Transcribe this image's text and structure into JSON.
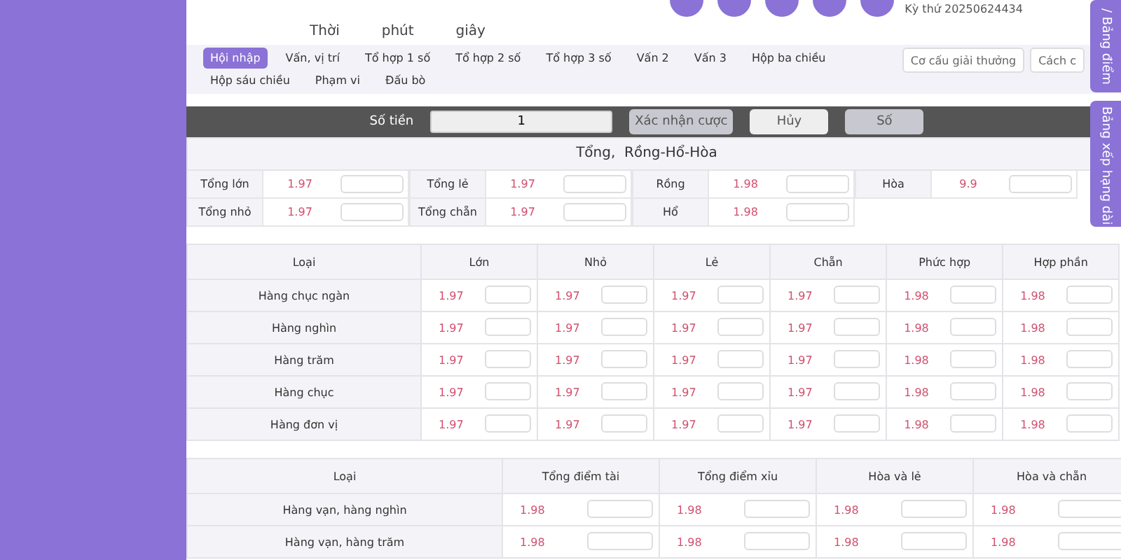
{
  "header": {
    "time_labels": [
      "Thời",
      "phút",
      "giây"
    ],
    "draw_label": "Kỳ thứ 20250624434"
  },
  "tabs": [
    {
      "label": "Hội nhập",
      "selected": true
    },
    {
      "label": "Vấn, vị trí",
      "selected": false
    },
    {
      "label": "Tổ hợp 1 số",
      "selected": false
    },
    {
      "label": "Tổ hợp 2 số",
      "selected": false
    },
    {
      "label": "Tổ hợp 3 số",
      "selected": false
    },
    {
      "label": "Vấn 2",
      "selected": false
    },
    {
      "label": "Vấn 3",
      "selected": false
    },
    {
      "label": "Hộp ba chiều",
      "selected": false
    },
    {
      "label": "Hộp sáu chiều",
      "selected": false
    },
    {
      "label": "Phạm vi",
      "selected": false
    },
    {
      "label": "Đấu bò",
      "selected": false
    }
  ],
  "nav_buttons": [
    "Cơ cấu giải thưởng",
    "Cách c"
  ],
  "side_tabs": [
    "/ Bảng điểm",
    "Bảng xếp hạng dài"
  ],
  "bet_bar": {
    "amount_label": "Số tiền",
    "amount": "1",
    "buttons": [
      {
        "label": "Xác nhận cược",
        "kind": "grey"
      },
      {
        "label": "Hủy",
        "kind": "light"
      },
      {
        "label": "Số",
        "kind": "grey"
      }
    ]
  },
  "summary": {
    "title": "Tổng,  Rồng-Hổ-Hòa",
    "cells": [
      {
        "label": "Tổng lớn",
        "odds": "1.97"
      },
      {
        "label": "Tổng lẻ",
        "odds": "1.97"
      },
      {
        "label": "Rồng",
        "odds": "1.98"
      },
      {
        "label": "Hòa",
        "odds": "9.9"
      },
      {
        "label": "Tổng nhỏ",
        "odds": "1.97"
      },
      {
        "label": "Tổng chẵn",
        "odds": "1.97"
      },
      {
        "label": "Hổ",
        "odds": "1.98"
      }
    ]
  },
  "tables": [
    {
      "columns": [
        "Loại",
        "Lớn",
        "Nhỏ",
        "Lẻ",
        "Chẵn",
        "Phức hợp",
        "Hợp phần"
      ],
      "rows": [
        {
          "label": "Hàng chục ngàn",
          "odds": [
            "1.97",
            "1.97",
            "1.97",
            "1.97",
            "1.98",
            "1.98"
          ]
        },
        {
          "label": "Hàng nghìn",
          "odds": [
            "1.97",
            "1.97",
            "1.97",
            "1.97",
            "1.98",
            "1.98"
          ]
        },
        {
          "label": "Hàng trăm",
          "odds": [
            "1.97",
            "1.97",
            "1.97",
            "1.97",
            "1.98",
            "1.98"
          ]
        },
        {
          "label": "Hàng chục",
          "odds": [
            "1.97",
            "1.97",
            "1.97",
            "1.97",
            "1.98",
            "1.98"
          ]
        },
        {
          "label": "Hàng đơn vị",
          "odds": [
            "1.97",
            "1.97",
            "1.97",
            "1.97",
            "1.98",
            "1.98"
          ]
        }
      ]
    },
    {
      "columns": [
        "Loại",
        "Tổng điểm tài",
        "Tổng điểm xỉu",
        "Hòa và lẻ",
        "Hòa và chẵn"
      ],
      "rows": [
        {
          "label": "Hàng vạn, hàng nghìn",
          "odds": [
            "1.98",
            "1.98",
            "1.98",
            "1.98"
          ]
        },
        {
          "label": "Hàng vạn, hàng trăm",
          "odds": [
            "1.98",
            "1.98",
            "1.98",
            "1.98"
          ]
        }
      ]
    }
  ]
}
